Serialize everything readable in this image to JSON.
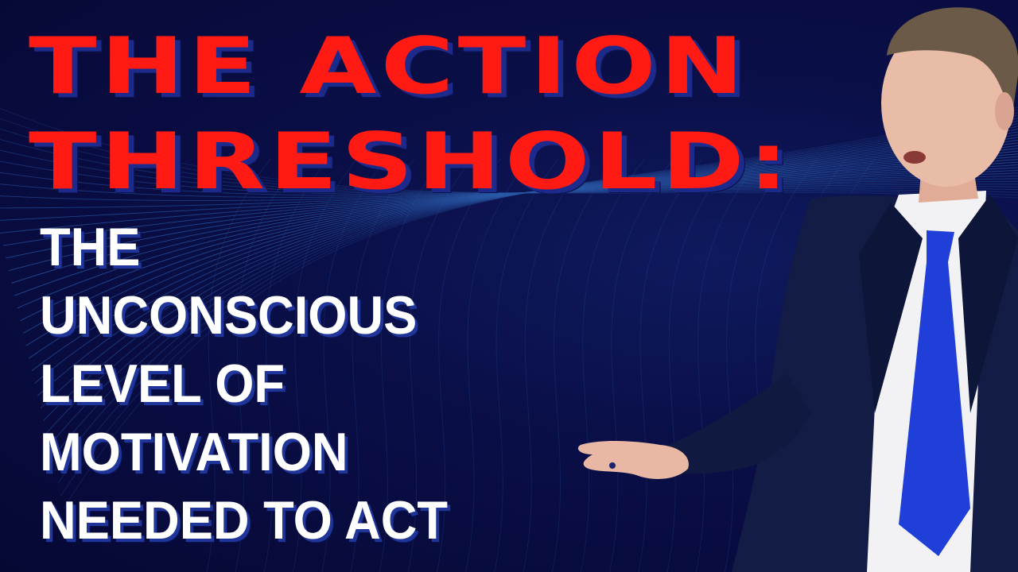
{
  "headline": {
    "line1": "THE ACTION",
    "line2": "THRESHOLD:"
  },
  "subheadline": {
    "lines": [
      "THE",
      "UNCONSCIOUS",
      "LEVEL OF",
      "MOTIVATION",
      "NEEDED TO ACT"
    ]
  },
  "colors": {
    "background": "#070a3a",
    "headline": "#ff1a14",
    "subheadline": "#ffffff",
    "mesh_lines": "#2a5aa8",
    "tie": "#1f3fd8",
    "suit": "#121c44"
  }
}
